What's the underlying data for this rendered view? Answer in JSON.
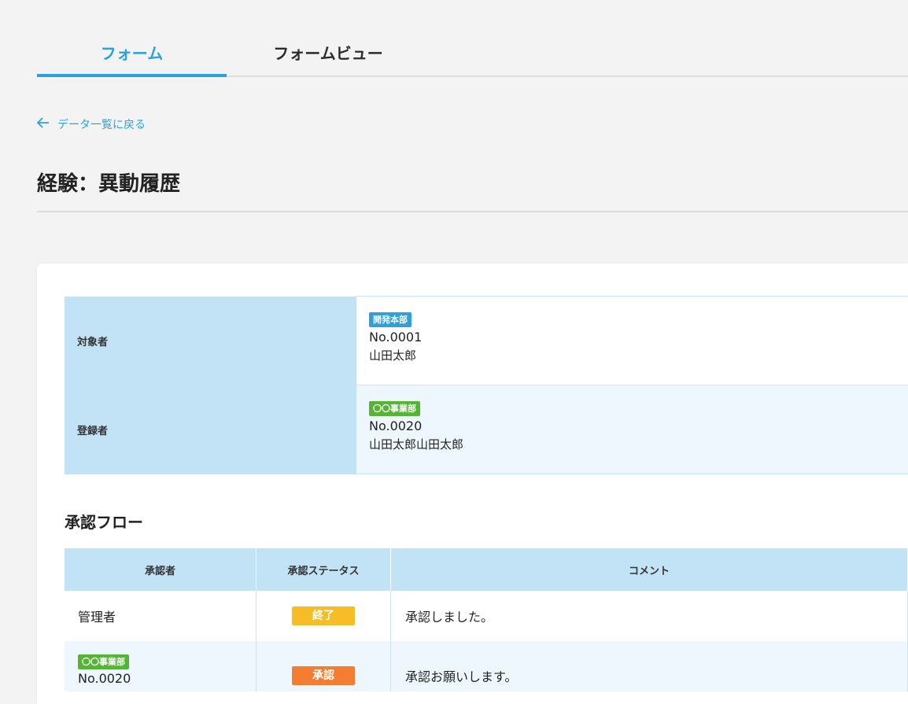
{
  "tabs": [
    {
      "label": "フォーム",
      "active": true
    },
    {
      "label": "フォームビュー",
      "active": false
    }
  ],
  "back_link": {
    "icon": "arrow-left-icon",
    "label": "データ一覧に戻る"
  },
  "page_title": "経験：異動履歴",
  "info": {
    "target": {
      "label": "対象者",
      "department": "開発本部",
      "department_color": "#2ea0dc",
      "number": "No.0001",
      "name": "山田太郎"
    },
    "registrant": {
      "label": "登録者",
      "department": "〇〇事業部",
      "department_color": "#55b435",
      "number": "No.0020",
      "name": "山田太郎山田太郎"
    }
  },
  "approval_flow": {
    "title": "承認フロー",
    "headers": [
      "承認者",
      "承認ステータス",
      "コメント"
    ],
    "rows": [
      {
        "approver": "管理者",
        "status": "終了",
        "status_color": "#f6bd26",
        "comment": "承認しました。"
      },
      {
        "approver_department": "〇〇事業部",
        "approver_number": "No.0020",
        "status": "承認",
        "status_color": "#f57d32",
        "comment": "承認お願いします。"
      }
    ]
  },
  "colors": {
    "accent": "#2aa1e1",
    "header_bg": "#c2e2f5"
  }
}
